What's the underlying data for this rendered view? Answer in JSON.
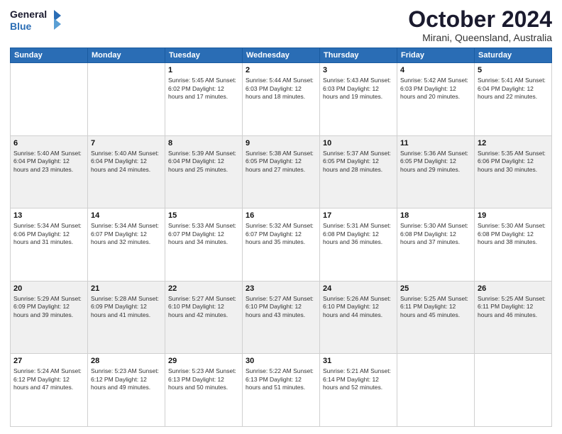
{
  "logo": {
    "line1": "General",
    "line2": "Blue"
  },
  "title": "October 2024",
  "subtitle": "Mirani, Queensland, Australia",
  "header_days": [
    "Sunday",
    "Monday",
    "Tuesday",
    "Wednesday",
    "Thursday",
    "Friday",
    "Saturday"
  ],
  "weeks": [
    [
      {
        "day": "",
        "info": ""
      },
      {
        "day": "",
        "info": ""
      },
      {
        "day": "1",
        "info": "Sunrise: 5:45 AM\nSunset: 6:02 PM\nDaylight: 12 hours\nand 17 minutes."
      },
      {
        "day": "2",
        "info": "Sunrise: 5:44 AM\nSunset: 6:03 PM\nDaylight: 12 hours\nand 18 minutes."
      },
      {
        "day": "3",
        "info": "Sunrise: 5:43 AM\nSunset: 6:03 PM\nDaylight: 12 hours\nand 19 minutes."
      },
      {
        "day": "4",
        "info": "Sunrise: 5:42 AM\nSunset: 6:03 PM\nDaylight: 12 hours\nand 20 minutes."
      },
      {
        "day": "5",
        "info": "Sunrise: 5:41 AM\nSunset: 6:04 PM\nDaylight: 12 hours\nand 22 minutes."
      }
    ],
    [
      {
        "day": "6",
        "info": "Sunrise: 5:40 AM\nSunset: 6:04 PM\nDaylight: 12 hours\nand 23 minutes."
      },
      {
        "day": "7",
        "info": "Sunrise: 5:40 AM\nSunset: 6:04 PM\nDaylight: 12 hours\nand 24 minutes."
      },
      {
        "day": "8",
        "info": "Sunrise: 5:39 AM\nSunset: 6:04 PM\nDaylight: 12 hours\nand 25 minutes."
      },
      {
        "day": "9",
        "info": "Sunrise: 5:38 AM\nSunset: 6:05 PM\nDaylight: 12 hours\nand 27 minutes."
      },
      {
        "day": "10",
        "info": "Sunrise: 5:37 AM\nSunset: 6:05 PM\nDaylight: 12 hours\nand 28 minutes."
      },
      {
        "day": "11",
        "info": "Sunrise: 5:36 AM\nSunset: 6:05 PM\nDaylight: 12 hours\nand 29 minutes."
      },
      {
        "day": "12",
        "info": "Sunrise: 5:35 AM\nSunset: 6:06 PM\nDaylight: 12 hours\nand 30 minutes."
      }
    ],
    [
      {
        "day": "13",
        "info": "Sunrise: 5:34 AM\nSunset: 6:06 PM\nDaylight: 12 hours\nand 31 minutes."
      },
      {
        "day": "14",
        "info": "Sunrise: 5:34 AM\nSunset: 6:07 PM\nDaylight: 12 hours\nand 32 minutes."
      },
      {
        "day": "15",
        "info": "Sunrise: 5:33 AM\nSunset: 6:07 PM\nDaylight: 12 hours\nand 34 minutes."
      },
      {
        "day": "16",
        "info": "Sunrise: 5:32 AM\nSunset: 6:07 PM\nDaylight: 12 hours\nand 35 minutes."
      },
      {
        "day": "17",
        "info": "Sunrise: 5:31 AM\nSunset: 6:08 PM\nDaylight: 12 hours\nand 36 minutes."
      },
      {
        "day": "18",
        "info": "Sunrise: 5:30 AM\nSunset: 6:08 PM\nDaylight: 12 hours\nand 37 minutes."
      },
      {
        "day": "19",
        "info": "Sunrise: 5:30 AM\nSunset: 6:08 PM\nDaylight: 12 hours\nand 38 minutes."
      }
    ],
    [
      {
        "day": "20",
        "info": "Sunrise: 5:29 AM\nSunset: 6:09 PM\nDaylight: 12 hours\nand 39 minutes."
      },
      {
        "day": "21",
        "info": "Sunrise: 5:28 AM\nSunset: 6:09 PM\nDaylight: 12 hours\nand 41 minutes."
      },
      {
        "day": "22",
        "info": "Sunrise: 5:27 AM\nSunset: 6:10 PM\nDaylight: 12 hours\nand 42 minutes."
      },
      {
        "day": "23",
        "info": "Sunrise: 5:27 AM\nSunset: 6:10 PM\nDaylight: 12 hours\nand 43 minutes."
      },
      {
        "day": "24",
        "info": "Sunrise: 5:26 AM\nSunset: 6:10 PM\nDaylight: 12 hours\nand 44 minutes."
      },
      {
        "day": "25",
        "info": "Sunrise: 5:25 AM\nSunset: 6:11 PM\nDaylight: 12 hours\nand 45 minutes."
      },
      {
        "day": "26",
        "info": "Sunrise: 5:25 AM\nSunset: 6:11 PM\nDaylight: 12 hours\nand 46 minutes."
      }
    ],
    [
      {
        "day": "27",
        "info": "Sunrise: 5:24 AM\nSunset: 6:12 PM\nDaylight: 12 hours\nand 47 minutes."
      },
      {
        "day": "28",
        "info": "Sunrise: 5:23 AM\nSunset: 6:12 PM\nDaylight: 12 hours\nand 49 minutes."
      },
      {
        "day": "29",
        "info": "Sunrise: 5:23 AM\nSunset: 6:13 PM\nDaylight: 12 hours\nand 50 minutes."
      },
      {
        "day": "30",
        "info": "Sunrise: 5:22 AM\nSunset: 6:13 PM\nDaylight: 12 hours\nand 51 minutes."
      },
      {
        "day": "31",
        "info": "Sunrise: 5:21 AM\nSunset: 6:14 PM\nDaylight: 12 hours\nand 52 minutes."
      },
      {
        "day": "",
        "info": ""
      },
      {
        "day": "",
        "info": ""
      }
    ]
  ]
}
